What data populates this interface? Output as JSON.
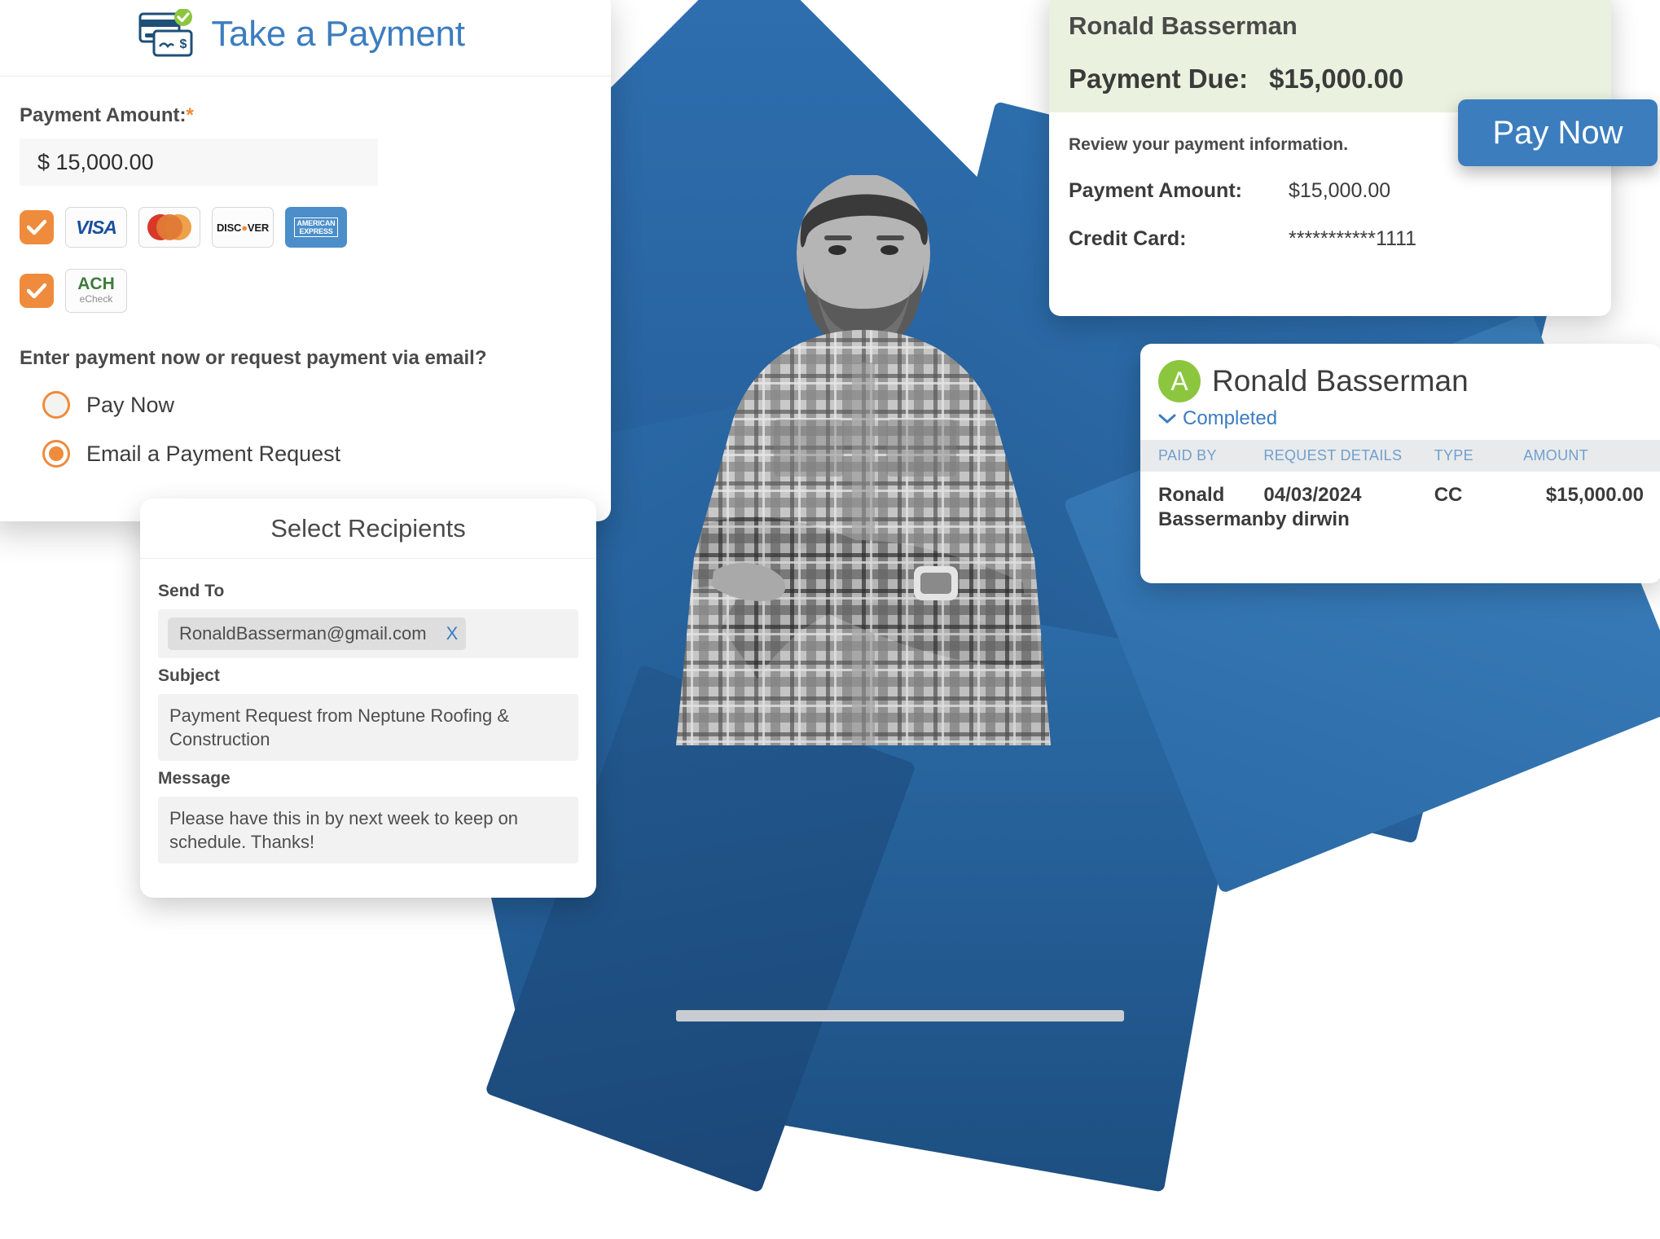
{
  "take_payment": {
    "title": "Take a Payment",
    "icon": "credit-card-check-icon",
    "amount_label": "Payment Amount:",
    "required_mark": "*",
    "amount_value": "$ 15,000.00",
    "cards_checkbox_checked": true,
    "ach_checkbox_checked": true,
    "brands": [
      {
        "name": "visa",
        "label": "VISA"
      },
      {
        "name": "mastercard",
        "label": ""
      },
      {
        "name": "discover",
        "label": "DISC",
        "label2": "VER"
      },
      {
        "name": "amex",
        "label": "AMERICAN",
        "label2": "EXPRESS"
      }
    ],
    "ach": {
      "line1": "ACH",
      "line2": "eCheck"
    },
    "question": "Enter payment now or request payment via email?",
    "options": [
      {
        "label": "Pay Now",
        "selected": false
      },
      {
        "label": "Email a Payment Request",
        "selected": true
      }
    ]
  },
  "select_recipients": {
    "title": "Select Recipients",
    "send_to_label": "Send To",
    "recipient_chip": "RonaldBasserman@gmail.com",
    "chip_remove": "X",
    "subject_label": "Subject",
    "subject_value": "Payment Request from Neptune Roofing & Construction",
    "message_label": "Message",
    "message_value": "Please have this in by next week to keep on schedule. Thanks!"
  },
  "payment_due": {
    "customer_name": "Ronald Basserman",
    "due_label": "Payment Due:",
    "due_amount": "$15,000.00",
    "review_text": "Review your payment information.",
    "rows": [
      {
        "key": "Payment Amount:",
        "value": "$15,000.00"
      },
      {
        "key": "Credit Card:",
        "value": "***********1111"
      }
    ],
    "pay_now_label": "Pay Now"
  },
  "completed": {
    "avatar_initial": "A",
    "customer_name": "Ronald Basserman",
    "status": "Completed",
    "status_chevron": "chevron-down-icon",
    "columns": [
      "PAID BY",
      "REQUEST DETAILS",
      "TYPE",
      "AMOUNT"
    ],
    "rows": [
      {
        "paid_by": "Ronald Basserman",
        "request_details_line1": "04/03/2024",
        "request_details_line2": "by dirwin",
        "type": "CC",
        "amount": "$15,000.00"
      }
    ]
  },
  "colors": {
    "brand_blue": "#3c7dbe",
    "accent_orange": "#ef8b3c",
    "green_panel": "#eaf1de",
    "avatar_green": "#8cc63f",
    "dark_blue": "#1c4f80"
  }
}
